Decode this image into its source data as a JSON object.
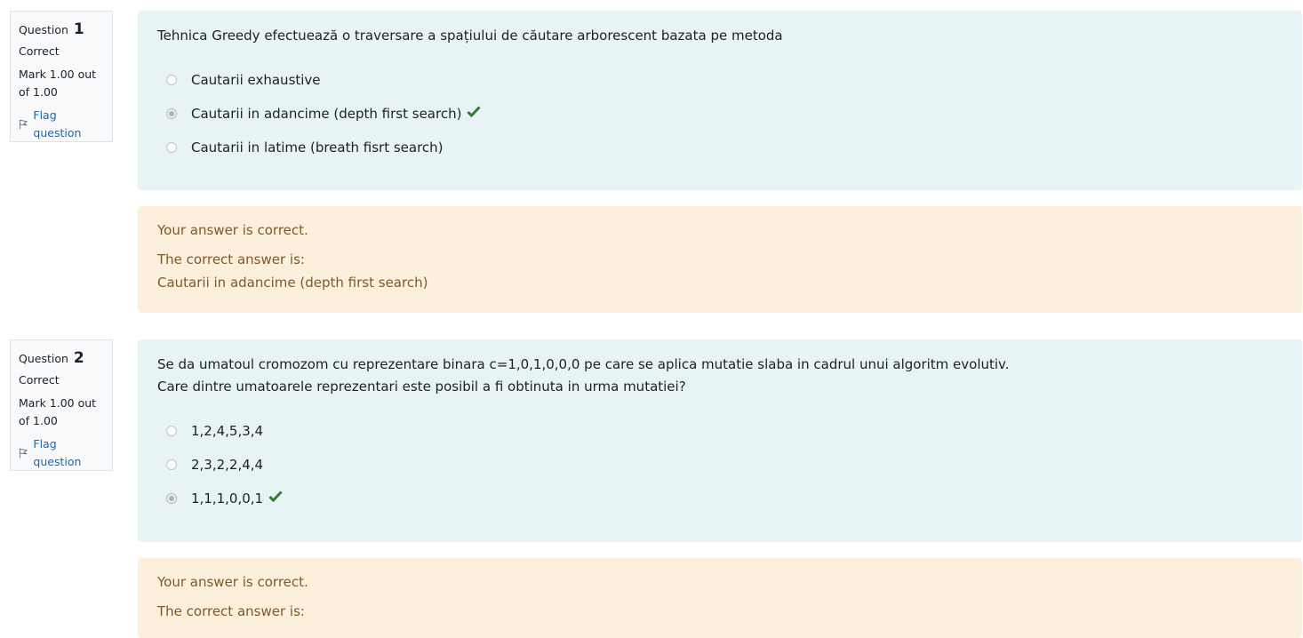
{
  "questions": [
    {
      "label": "Question",
      "number": "1",
      "state": "Correct",
      "grade": "Mark 1.00 out of 1.00",
      "flag_label": "Flag question",
      "text_lines": [
        "Tehnica Greedy efectuează o traversare a spațiului de căutare arborescent bazata pe metoda"
      ],
      "answers": [
        {
          "label": "Cautarii exhaustive",
          "selected": false,
          "correct_mark": false
        },
        {
          "label": "Cautarii in adancime (depth first search)",
          "selected": true,
          "correct_mark": true
        },
        {
          "label": "Cautarii in latime (breath fisrt search)",
          "selected": false,
          "correct_mark": false
        }
      ],
      "feedback": "Your answer is correct.",
      "correct_answer_label": "The correct answer is:",
      "correct_answer": "Cautarii in adancime (depth first search)"
    },
    {
      "label": "Question",
      "number": "2",
      "state": "Correct",
      "grade": "Mark 1.00 out of 1.00",
      "flag_label": "Flag question",
      "text_lines": [
        "Se da umatoul cromozom cu reprezentare binara c=1,0,1,0,0,0 pe care se aplica mutatie slaba in cadrul unui algoritm evolutiv.",
        "Care dintre umatoarele reprezentari este posibil a fi obtinuta in urma mutatiei?"
      ],
      "answers": [
        {
          "label": "1,2,4,5,3,4",
          "selected": false,
          "correct_mark": false
        },
        {
          "label": "2,3,2,2,4,4",
          "selected": false,
          "correct_mark": false
        },
        {
          "label": "1,1,1,0,0,1",
          "selected": true,
          "correct_mark": true
        }
      ],
      "feedback": "Your answer is correct.",
      "correct_answer_label": "The correct answer is:",
      "correct_answer": ""
    }
  ],
  "colors": {
    "correct_check": "#357a32",
    "link": "#0f6cbf",
    "outcome_text": "#7d5a29"
  }
}
